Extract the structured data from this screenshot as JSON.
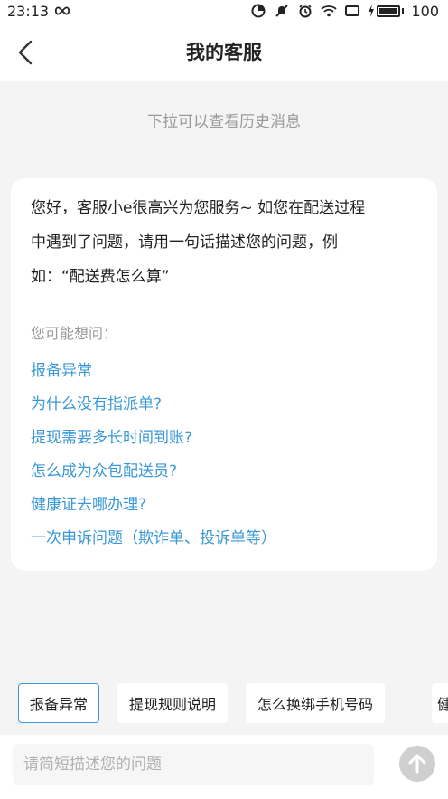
{
  "status_bar": {
    "time": "23:13",
    "battery_level": "100",
    "icons": [
      "infinity-icon",
      "data-saver-icon",
      "mute-icon",
      "alarm-icon",
      "wifi-icon",
      "screen-icon",
      "charging-icon",
      "battery-icon"
    ]
  },
  "header": {
    "title": "我的客服",
    "back_icon": "chevron-left-icon"
  },
  "chat": {
    "pull_hint": "下拉可以查看历史消息",
    "welcome_lines": [
      "您好，客服小e很高兴为您服务~ 如您在配送过程",
      "中遇到了问题，请用一句话描述您的问题，例",
      "如：“配送费怎么算”"
    ],
    "suggest_title": "您可能想问：",
    "suggestions": [
      "报备异常",
      "为什么没有指派单?",
      "提现需要多长时间到账?",
      "怎么成为众包配送员?",
      "健康证去哪办理?",
      "一次申诉问题（欺诈单、投诉单等）"
    ]
  },
  "quick_chips": [
    "报备异常",
    "提现规则说明",
    "怎么换绑手机号码",
    "健"
  ],
  "input": {
    "placeholder": "请简短描述您的问题",
    "value": ""
  },
  "colors": {
    "accent": "#3a98d6",
    "background": "#f4f4f4",
    "send_button": "#cfcfcf"
  }
}
